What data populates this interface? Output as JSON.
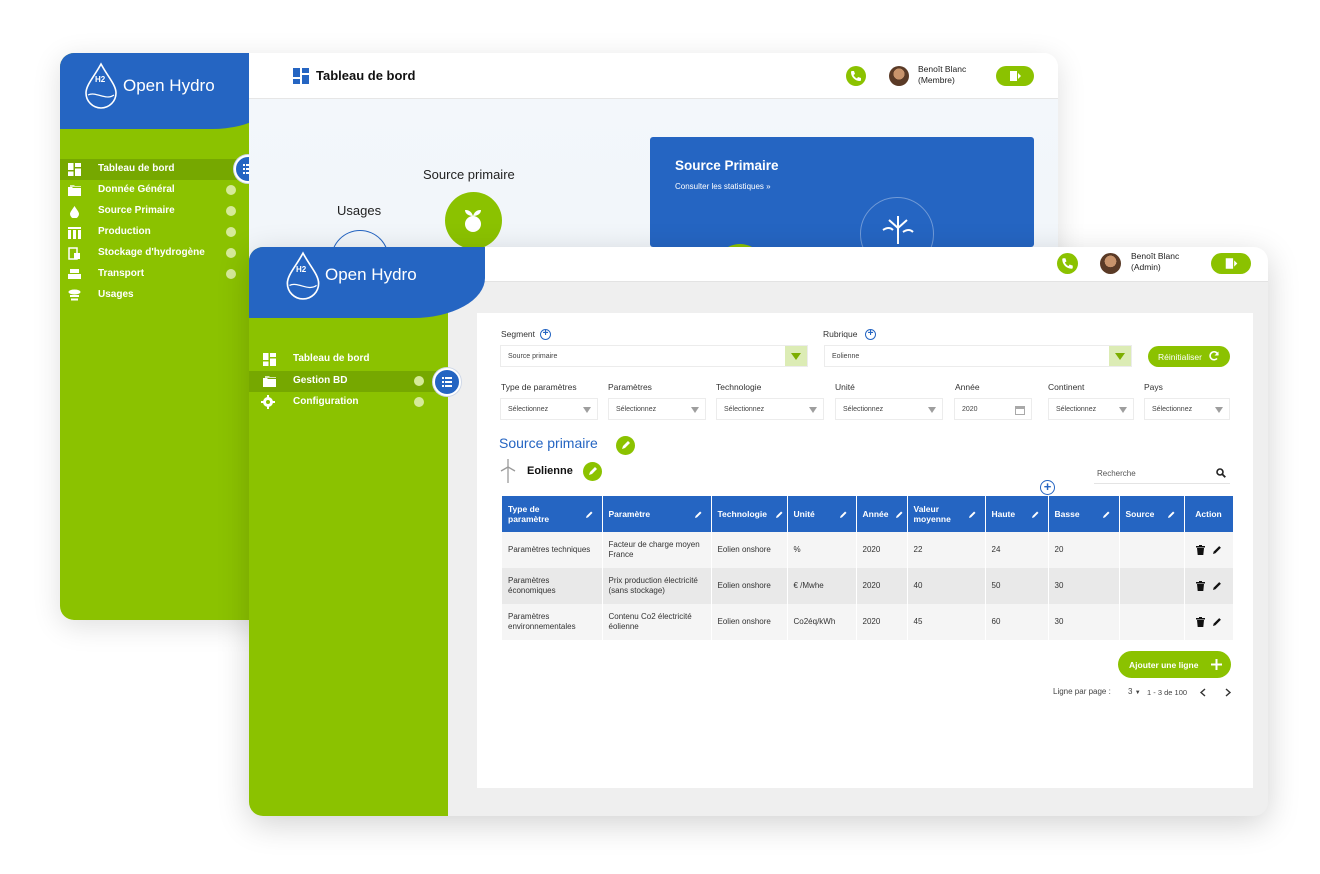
{
  "back": {
    "logo": {
      "badge": "H2",
      "text": "Open Hydro"
    },
    "header": {
      "title": "Tableau de bord"
    },
    "user": {
      "name": "Benoît Blanc",
      "role": "(Membre)"
    },
    "menu": [
      {
        "label": "Tableau de bord",
        "icon": "dashboard-icon",
        "active": true
      },
      {
        "label": "Donnée Général",
        "icon": "folders-icon"
      },
      {
        "label": "Source Primaire",
        "icon": "water-drop-icon"
      },
      {
        "label": "Production",
        "icon": "factory-icon"
      },
      {
        "label": "Stockage d'hydrogène",
        "icon": "storage-icon"
      },
      {
        "label": "Transport",
        "icon": "truck-icon"
      },
      {
        "label": "Usages",
        "icon": "usage-icon"
      }
    ],
    "dashboard": {
      "source_label": "Source primaire",
      "usages_label": "Usages",
      "card_title": "Source Primaire",
      "card_link": "Consulter les statistiques »"
    }
  },
  "front": {
    "logo": {
      "badge": "H2",
      "text": "Open Hydro"
    },
    "user": {
      "name": "Benoît Blanc",
      "role": "(Admin)"
    },
    "menu": [
      {
        "label": "Tableau de bord",
        "icon": "dashboard-icon"
      },
      {
        "label": "Gestion BD",
        "icon": "folders-icon",
        "active": true
      },
      {
        "label": "Configuration",
        "icon": "gear-icon"
      }
    ],
    "filters": {
      "segment_label": "Segment",
      "segment_value": "Source primaire",
      "rubrique_label": "Rubrique",
      "rubrique_value": "Eolienne",
      "reset_label": "Réinitialiser",
      "fields": [
        {
          "label": "Type de paramètres",
          "value": "Sélectionnez"
        },
        {
          "label": "Paramètres",
          "value": "Sélectionnez"
        },
        {
          "label": "Technologie",
          "value": "Sélectionnez"
        },
        {
          "label": "Unité",
          "value": "Sélectionnez"
        },
        {
          "label": "Année",
          "value": "2020"
        },
        {
          "label": "Continent",
          "value": "Sélectionnez"
        },
        {
          "label": "Pays",
          "value": "Sélectionnez"
        }
      ]
    },
    "section_title": "Source primaire",
    "sub_title": "Eolienne",
    "search_placeholder": "Recherche",
    "table": {
      "headers": [
        "Type de paramètre",
        "Paramètre",
        "Technologie",
        "Unité",
        "Année",
        "Valeur moyenne",
        "Haute",
        "Basse",
        "Source",
        "Action"
      ],
      "rows": [
        [
          "Paramètres techniques",
          "Facteur de charge moyen France",
          "Eolien onshore",
          "%",
          "2020",
          "22",
          "24",
          "20",
          ""
        ],
        [
          "Paramètres économiques",
          "Prix production électricité (sans stockage)",
          "Eolien onshore",
          "€ /Mwhe",
          "2020",
          "40",
          "50",
          "30",
          ""
        ],
        [
          "Paramètres environnementales",
          "Contenu Co2 électricité éolienne",
          "Eolien onshore",
          "Co2éq/kWh",
          "2020",
          "45",
          "60",
          "30",
          ""
        ]
      ]
    },
    "add_row_label": "Ajouter une ligne",
    "pagination": {
      "rows_label": "Ligne par page :",
      "rows_value": "3",
      "range": "1 - 3 de 100"
    }
  },
  "colors": {
    "green": "#8bc200",
    "blue": "#2565c2"
  }
}
